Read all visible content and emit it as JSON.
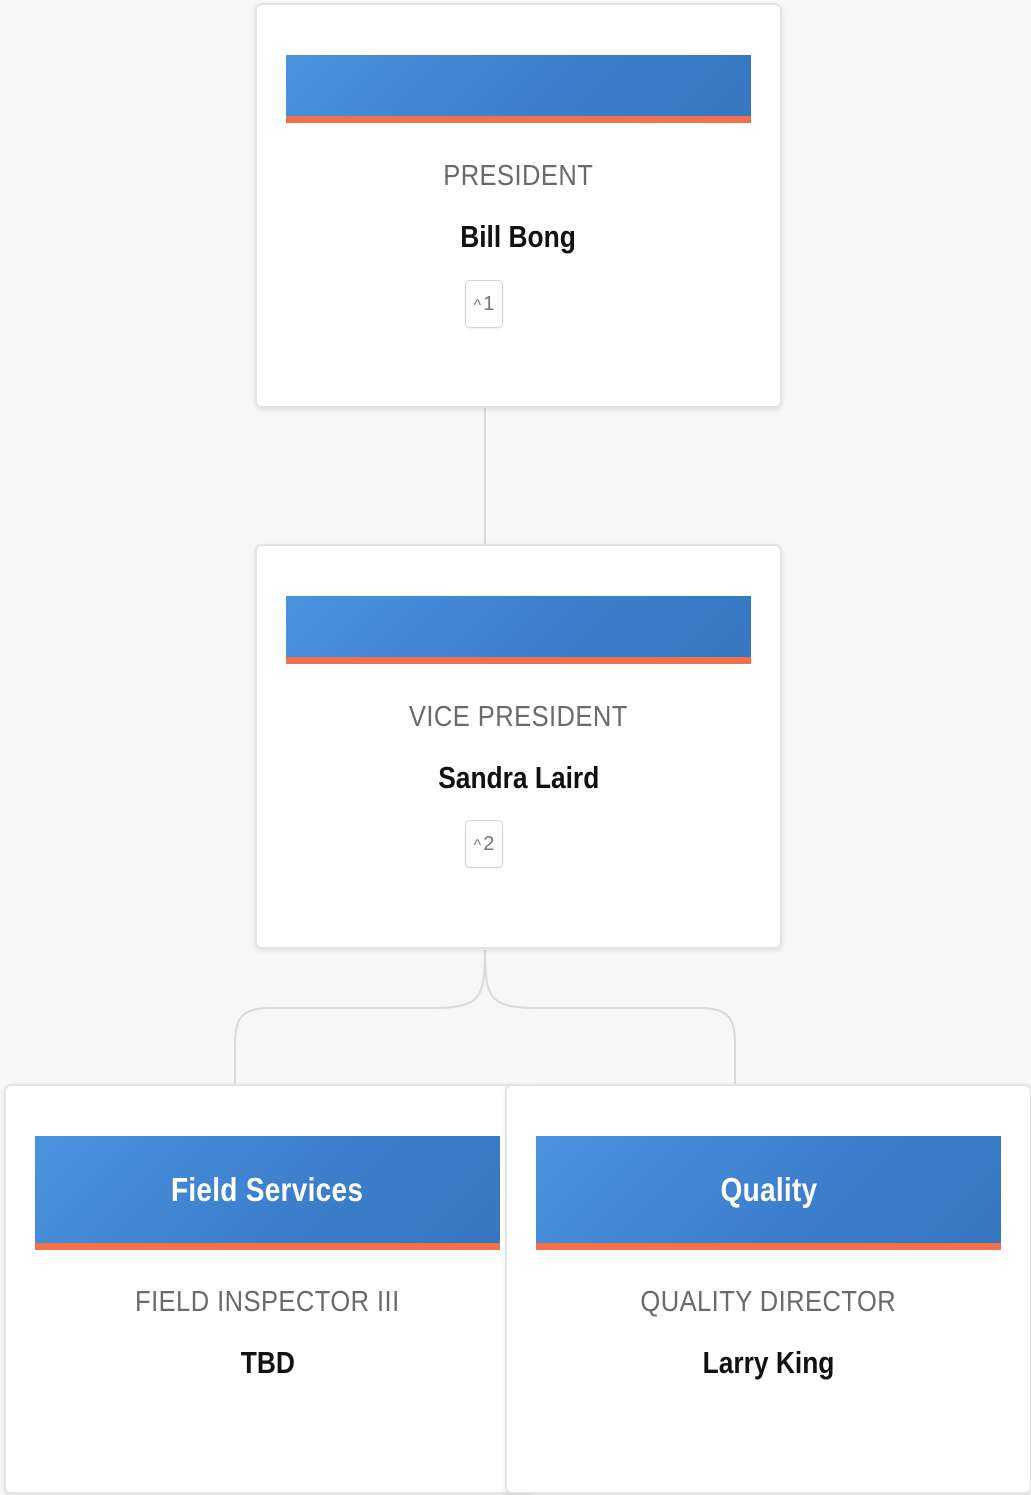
{
  "chart": {
    "nodes": [
      {
        "id": "president",
        "department": "",
        "title": "PRESIDENT",
        "name": "Bill Bong",
        "children_count": "1",
        "collapse_symbol": "^"
      },
      {
        "id": "vice-president",
        "department": "",
        "title": "VICE PRESIDENT",
        "name": "Sandra Laird",
        "children_count": "2",
        "collapse_symbol": "^"
      },
      {
        "id": "field-services",
        "department": "Field Services",
        "title": "FIELD INSPECTOR III",
        "name": "TBD"
      },
      {
        "id": "quality",
        "department": "Quality",
        "title": "QUALITY DIRECTOR",
        "name": "Larry King"
      }
    ]
  },
  "colors": {
    "header_blue": "#3f84d2",
    "header_accent": "#f2714a",
    "background": "#f7f7f8",
    "connector": "#d9d9db"
  }
}
